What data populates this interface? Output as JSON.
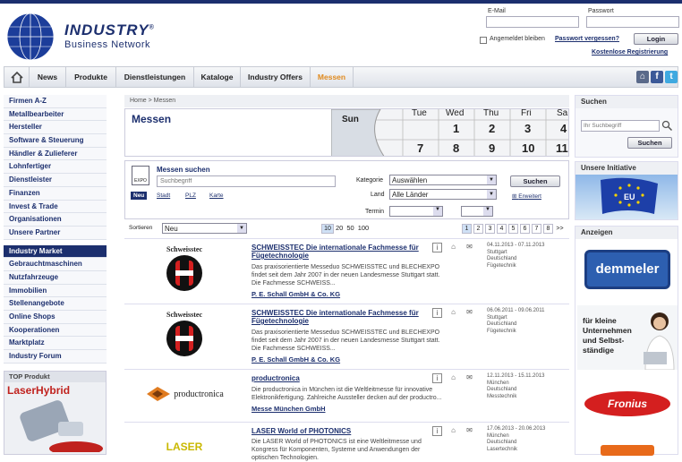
{
  "header": {
    "brand_line1": "INDUSTRY",
    "brand_reg": "®",
    "brand_line2": "Business Network",
    "email_label": "E-Mail",
    "password_label": "Passwort",
    "remember_label": "Angemeldet bleiben",
    "forgot_link": "Passwort vergessen?",
    "login_button": "Login",
    "register_link": "Kostenlose Registrierung"
  },
  "nav": {
    "items": [
      "News",
      "Produkte",
      "Dienstleistungen",
      "Kataloge",
      "Industry Offers",
      "Messen"
    ],
    "active": "Messen"
  },
  "sidebar": {
    "items": [
      "Firmen A-Z",
      "Metallbearbeiter",
      "Hersteller",
      "Software & Steuerung",
      "Händler & Zulieferer",
      "Lohnfertiger",
      "Dienstleister",
      "Finanzen",
      "Invest & Trade",
      "Organisationen",
      "Unsere Partner"
    ],
    "market_header": "Industry Market",
    "market_items": [
      "Gebrauchtmaschinen",
      "Nutzfahrzeuge",
      "Immobilien",
      "Stellenangebote",
      "Online Shops",
      "Kooperationen",
      "Marktplatz",
      "Industry Forum"
    ],
    "top_product_header": "TOP Produkt",
    "top_product_name": "LaserHybrid"
  },
  "breadcrumb": "Home > Messen",
  "page_title": "Messen",
  "calendar": {
    "days": [
      "Sun",
      "Tue",
      "Wed",
      "Thu",
      "Fri",
      "Sa"
    ],
    "numbers": [
      "1",
      "2",
      "3",
      "4",
      "7",
      "8",
      "9",
      "10",
      "11"
    ]
  },
  "search": {
    "title": "Messen suchen",
    "expo_label": "EXPO",
    "placeholder": "Suchbegriff",
    "tabs": [
      "Neu",
      "Stadt",
      "PLZ",
      "Karte"
    ],
    "kategorie_label": "Kategorie",
    "kategorie_value": "Auswählen",
    "land_label": "Land",
    "land_value": "Alle Länder",
    "termin_label": "Termin",
    "search_button": "Suchen",
    "extended_link": "Erweitert"
  },
  "sort": {
    "label": "Sortieren",
    "value": "Neu",
    "per_page": [
      "10",
      "20",
      "50",
      "100"
    ],
    "pages": [
      "1",
      "2",
      "3",
      "4",
      "5",
      "6",
      "7",
      "8",
      ">>"
    ]
  },
  "entries": [
    {
      "logo_text": "Schweisstec",
      "title": "SCHWEISSTEC Die internationale Fachmesse für Fügetechnologie",
      "desc": "Das praxisorientierte Messeduo SCHWEISSTEC und BLECHEXPO findet seit dem Jahr 2007 in der neuen Landesmesse Stuttgart statt. Die Fachmesse SCHWEISS...",
      "organizer": "P. E. Schall GmbH & Co. KG",
      "date": "04.11.2013 - 07.11.2013",
      "city": "Stuttgart",
      "country": "Deutschland",
      "category": "Fügetechnik"
    },
    {
      "logo_text": "Schweisstec",
      "title": "SCHWEISSTEC Die internationale Fachmesse für Fügetechnologie",
      "desc": "Das praxisorientierte Messeduo SCHWEISSTEC und BLECHEXPO findet seit dem Jahr 2007 in der neuen Landesmesse Stuttgart statt. Die Fachmesse SCHWEISS...",
      "organizer": "P. E. Schall GmbH & Co. KG",
      "date": "06.06.2011 - 09.06.2011",
      "city": "Stuttgart",
      "country": "Deutschland",
      "category": "Fügetechnik"
    },
    {
      "logo_text": "productronica",
      "title": "productronica",
      "desc": "Die productronica in München ist die Weltleitmesse für innovative Elektronikfertigung. Zahlreiche Aussteller decken auf der productro...",
      "organizer": "Messe München GmbH",
      "date": "12.11.2013 - 15.11.2013",
      "city": "München",
      "country": "Deutschland",
      "category": "Messtechnik"
    },
    {
      "logo_text": "LASER",
      "title": "LASER World of PHOTONICS",
      "desc": "Die LASER World of PHOTONICS ist eine Weltleitmesse und Kongress für Komponenten, Systeme und Anwendungen der optischen Technologien.",
      "organizer": "",
      "date": "17.06.2013 - 20.06.2013",
      "city": "München",
      "country": "Deutschland",
      "category": "Lasertechnik"
    }
  ],
  "right": {
    "search_header": "Suchen",
    "search_placeholder": "Ihr Suchbegriff",
    "search_button": "Suchen",
    "initiative_header": "Unsere Initiative",
    "eu_label": "EU",
    "ads_header": "Anzeigen",
    "ad1": "demmeler",
    "ad2_text": "für kleine Unternehmen und Selbst-ständige",
    "ad3": "Fronius"
  },
  "colors": {
    "brand": "#1c2f6e",
    "accent": "#e08a1e"
  }
}
